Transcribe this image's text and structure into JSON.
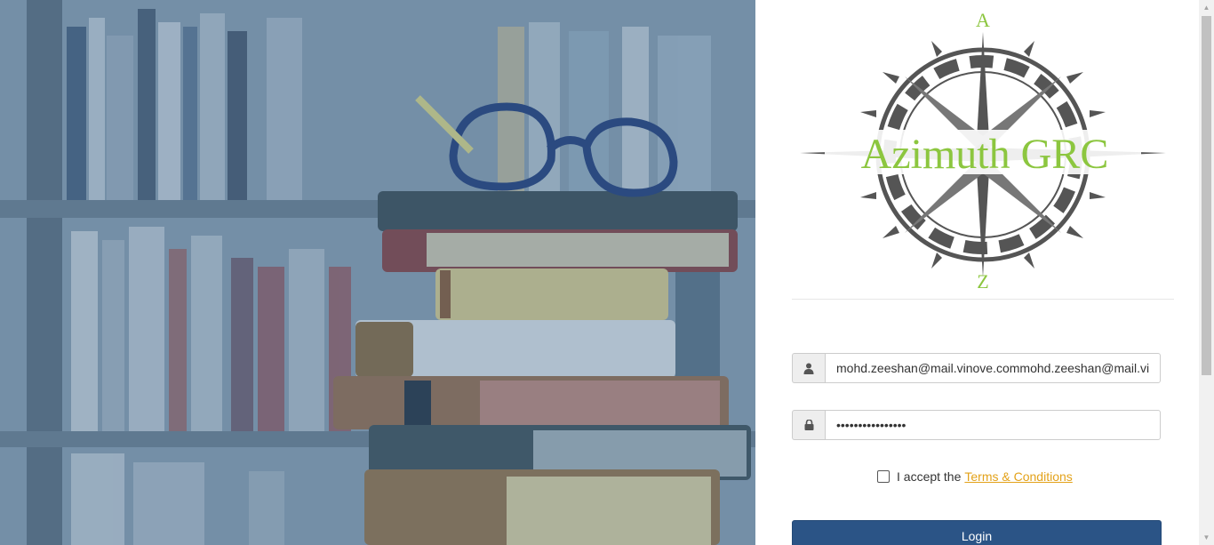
{
  "hero": {
    "alt": "Stack of old books with glasses in a library"
  },
  "logo": {
    "brand": "Azimuth GRC",
    "north": "A",
    "south": "Z",
    "brand_color": "#8cc63f",
    "compass_color": "#555555"
  },
  "login_form": {
    "email_icon": "user-icon",
    "email_value": "mohd.zeeshan@mail.vinove.commohd.zeeshan@mail.vi",
    "password_icon": "lock-icon",
    "password_value": "••••••••••••••••",
    "terms_prefix": "I accept the",
    "terms_link": "Terms & Conditions",
    "terms_checked": false,
    "login_label": "Login"
  },
  "colors": {
    "button": "#2b5486",
    "link": "#e3a21a"
  }
}
